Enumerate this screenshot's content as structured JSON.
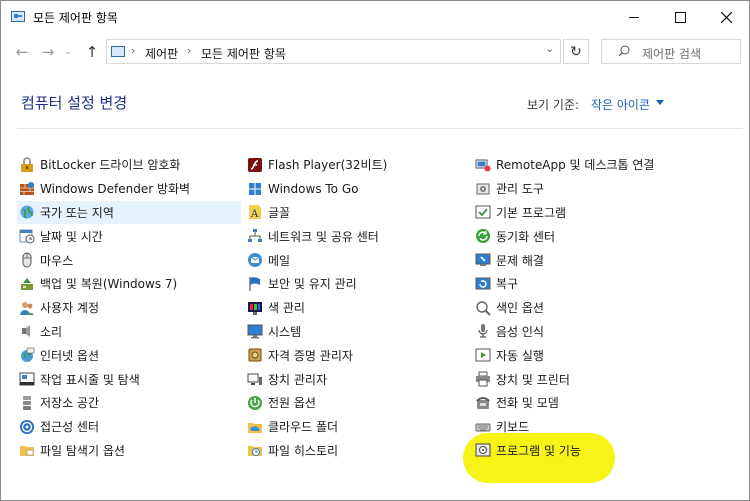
{
  "window": {
    "title": "모든 제어판 항목"
  },
  "nav": {
    "breadcrumb": [
      "제어판",
      "모든 제어판 항목"
    ],
    "search_placeholder": "제어판 검색"
  },
  "header": {
    "title": "컴퓨터 설정 변경",
    "view_by_label": "보기 기준:",
    "view_by_value": "작은 아이콘"
  },
  "columns": [
    [
      {
        "label": "BitLocker 드라이브 암호화",
        "icon": "bitlocker-icon"
      },
      {
        "label": "Windows Defender 방화벽",
        "icon": "firewall-icon"
      },
      {
        "label": "국가 또는 지역",
        "icon": "globe-icon"
      },
      {
        "label": "날짜 및 시간",
        "icon": "clock-icon"
      },
      {
        "label": "마우스",
        "icon": "mouse-icon"
      },
      {
        "label": "백업 및 복원(Windows 7)",
        "icon": "backup-icon"
      },
      {
        "label": "사용자 계정",
        "icon": "users-icon"
      },
      {
        "label": "소리",
        "icon": "speaker-icon"
      },
      {
        "label": "인터넷 옵션",
        "icon": "internet-icon"
      },
      {
        "label": "작업 표시줄 및 탐색",
        "icon": "taskbar-icon"
      },
      {
        "label": "저장소 공간",
        "icon": "storage-icon"
      },
      {
        "label": "접근성 센터",
        "icon": "accessibility-icon"
      },
      {
        "label": "파일 탐색기 옵션",
        "icon": "folder-options-icon"
      }
    ],
    [
      {
        "label": "Flash Player(32비트)",
        "icon": "flash-icon"
      },
      {
        "label": "Windows To Go",
        "icon": "windows-to-go-icon"
      },
      {
        "label": "글꼴",
        "icon": "font-icon"
      },
      {
        "label": "네트워크 및 공유 센터",
        "icon": "network-icon"
      },
      {
        "label": "메일",
        "icon": "mail-icon"
      },
      {
        "label": "보안 및 유지 관리",
        "icon": "flag-icon"
      },
      {
        "label": "색 관리",
        "icon": "color-icon"
      },
      {
        "label": "시스템",
        "icon": "system-icon"
      },
      {
        "label": "자격 증명 관리자",
        "icon": "credential-icon"
      },
      {
        "label": "장치 관리자",
        "icon": "device-manager-icon"
      },
      {
        "label": "전원 옵션",
        "icon": "power-icon"
      },
      {
        "label": "클라우드 폴더",
        "icon": "cloud-folder-icon"
      },
      {
        "label": "파일 히스토리",
        "icon": "file-history-icon"
      }
    ],
    [
      {
        "label": "RemoteApp 및 데스크톱 연결",
        "icon": "remoteapp-icon"
      },
      {
        "label": "관리 도구",
        "icon": "admin-tools-icon"
      },
      {
        "label": "기본 프로그램",
        "icon": "default-programs-icon"
      },
      {
        "label": "동기화 센터",
        "icon": "sync-icon"
      },
      {
        "label": "문제 해결",
        "icon": "troubleshoot-icon"
      },
      {
        "label": "복구",
        "icon": "recovery-icon"
      },
      {
        "label": "색인 옵션",
        "icon": "indexing-icon"
      },
      {
        "label": "음성 인식",
        "icon": "microphone-icon"
      },
      {
        "label": "자동 실행",
        "icon": "autoplay-icon"
      },
      {
        "label": "장치 및 프린터",
        "icon": "printer-icon"
      },
      {
        "label": "전화 및 모뎀",
        "icon": "phone-icon"
      },
      {
        "label": "키보드",
        "icon": "keyboard-icon"
      },
      {
        "label": "프로그램 및 기능",
        "icon": "programs-icon"
      }
    ]
  ]
}
